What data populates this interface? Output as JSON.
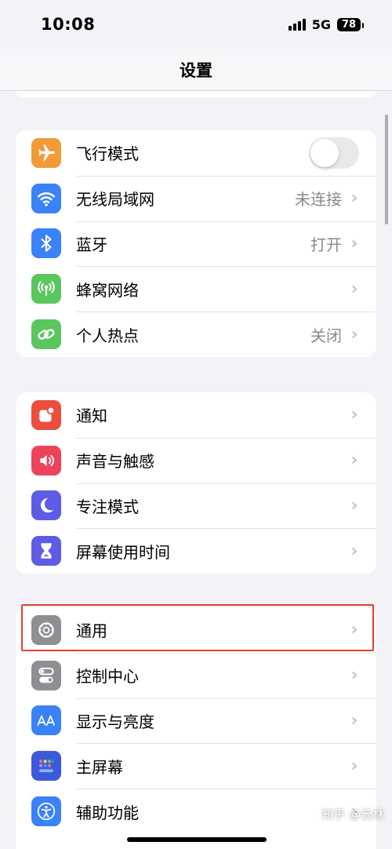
{
  "status": {
    "time": "10:08",
    "network": "5G",
    "battery": "78"
  },
  "nav": {
    "title": "设置"
  },
  "groups": [
    {
      "rows": [
        {
          "label": "飞行模式",
          "icon": "airplane-icon",
          "color": "#f19a37",
          "toggle": false
        },
        {
          "label": "无线局域网",
          "icon": "wifi-icon",
          "color": "#3a82f7",
          "value": "未连接"
        },
        {
          "label": "蓝牙",
          "icon": "bluetooth-icon",
          "color": "#3a82f7",
          "value": "打开"
        },
        {
          "label": "蜂窝网络",
          "icon": "cellular-icon",
          "color": "#5ac65e"
        },
        {
          "label": "个人热点",
          "icon": "hotspot-icon",
          "color": "#5ac65e",
          "value": "关闭"
        }
      ]
    },
    {
      "rows": [
        {
          "label": "通知",
          "icon": "notification-icon",
          "color": "#eb4e3d"
        },
        {
          "label": "声音与触感",
          "icon": "sound-icon",
          "color": "#eb445a"
        },
        {
          "label": "专注模式",
          "icon": "moon-icon",
          "color": "#5e5ce6"
        },
        {
          "label": "屏幕使用时间",
          "icon": "hourglass-icon",
          "color": "#5e5ce6"
        }
      ]
    },
    {
      "rows": [
        {
          "label": "通用",
          "icon": "gear-icon",
          "color": "#8e8e93"
        },
        {
          "label": "控制中心",
          "icon": "switches-icon",
          "color": "#8e8e93"
        },
        {
          "label": "显示与亮度",
          "icon": "text-size-icon",
          "color": "#3a82f7"
        },
        {
          "label": "主屏幕",
          "icon": "home-grid-icon",
          "color": "#3a5ad9"
        },
        {
          "label": "辅助功能",
          "icon": "accessibility-icon",
          "color": "#3a82f7"
        }
      ]
    }
  ],
  "watermark": "知乎 @云林"
}
